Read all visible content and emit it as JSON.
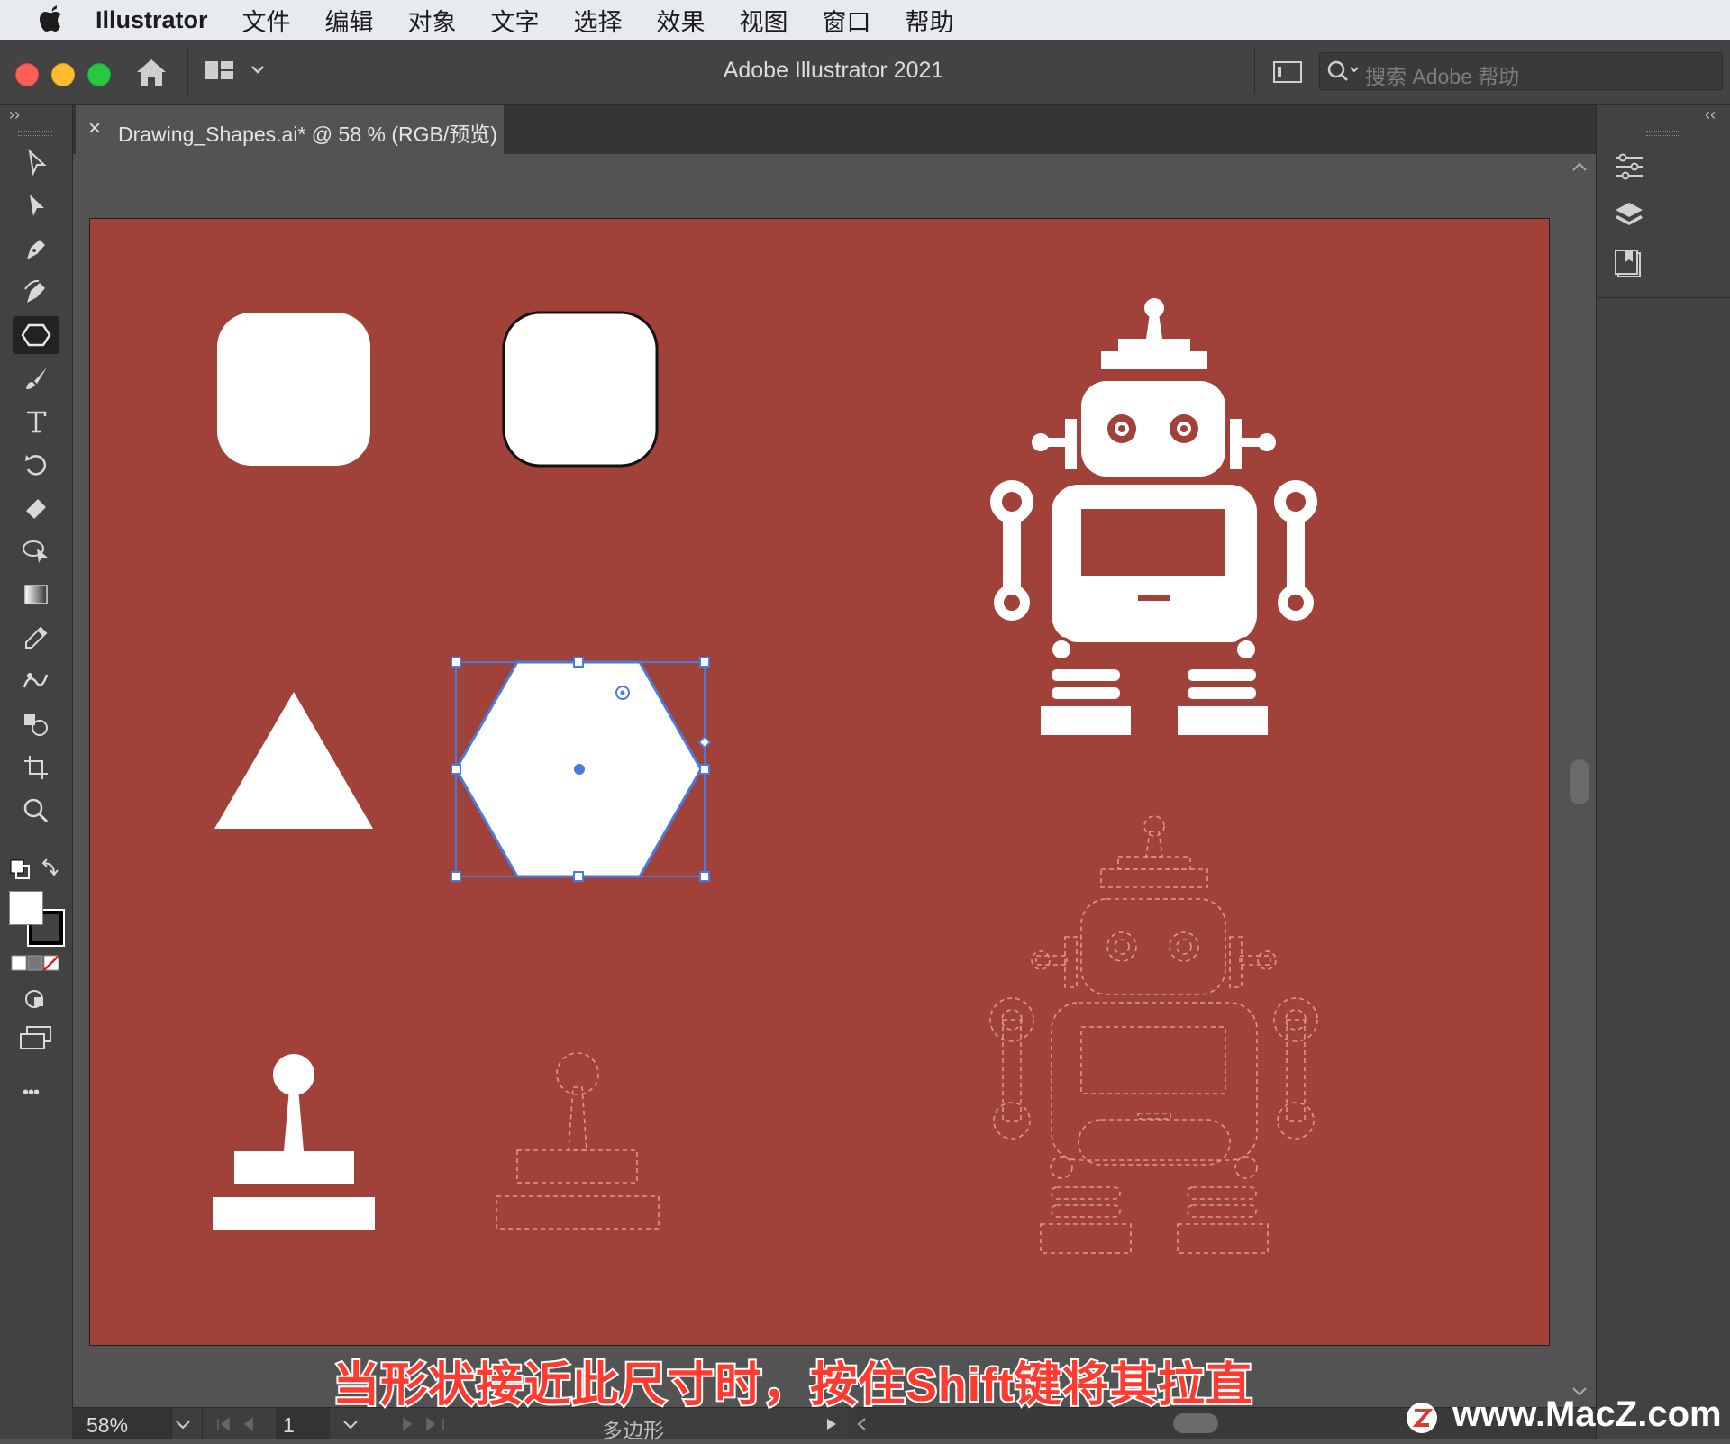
{
  "menubar": {
    "app_name": "Illustrator",
    "items": [
      "文件",
      "编辑",
      "对象",
      "文字",
      "选择",
      "效果",
      "视图",
      "窗口",
      "帮助"
    ]
  },
  "titlebar": {
    "title": "Adobe Illustrator 2021",
    "search_placeholder": "搜索 Adobe 帮助"
  },
  "document_tab": {
    "close_glyph": "×",
    "label": "Drawing_Shapes.ai* @ 58 % (RGB/预览)"
  },
  "panel_toggles": {
    "left": "››",
    "right": "‹‹"
  },
  "toolbar": {
    "tools": [
      "selection-tool",
      "direct-selection-tool",
      "pen-tool",
      "curvature-tool",
      "polygon-tool",
      "paintbrush-tool",
      "type-tool",
      "rotate-tool",
      "eraser-tool",
      "shape-builder-tool",
      "gradient-tool",
      "eyedropper-tool",
      "blend-tool",
      "symbol-sprayer-tool",
      "artboard-tool",
      "zoom-tool"
    ],
    "active_tool": "polygon-tool",
    "more_glyph": "•••"
  },
  "statusbar": {
    "zoom": "58%",
    "artboard_number": "1",
    "selection_info": "多边形"
  },
  "caption": "当形状接近此尺寸时，按住Shift键将其拉直",
  "watermark": "www.MacZ.com",
  "colors": {
    "artboard": "#a0413a",
    "selection": "#4a7bdc",
    "fill": "#ffffff"
  }
}
